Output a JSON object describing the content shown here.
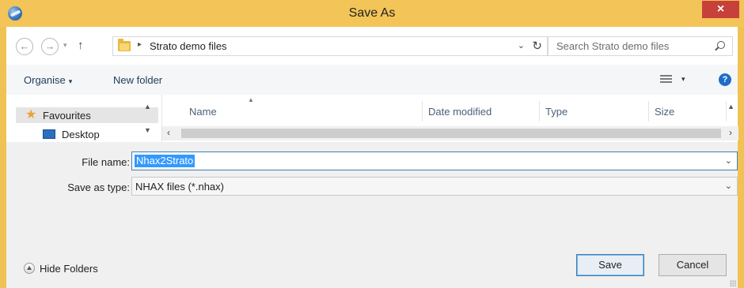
{
  "window": {
    "title": "Save As",
    "close_label": "×"
  },
  "address_bar": {
    "back_glyph": "←",
    "forward_glyph": "→",
    "up_glyph": "↑",
    "separator_glyph": "▸",
    "breadcrumb": "Strato demo files",
    "dropdown_glyph": "⌄",
    "refresh_glyph": "↻"
  },
  "search": {
    "placeholder": "Search Strato demo files"
  },
  "toolbar": {
    "organise_label": "Organise",
    "new_folder_label": "New folder",
    "help_glyph": "?"
  },
  "nav_pane": {
    "items": [
      {
        "label": "Favourites",
        "icon": "star-icon"
      },
      {
        "label": "Desktop",
        "icon": "desktop-icon"
      }
    ]
  },
  "file_list": {
    "columns": [
      "Name",
      "Date modified",
      "Type",
      "Size"
    ],
    "rows": []
  },
  "form": {
    "file_name_label": "File name:",
    "file_name_value": "Nhax2Strato",
    "save_type_label": "Save as type:",
    "save_type_value": "NHAX files (*.nhax)"
  },
  "footer": {
    "hide_folders_label": "Hide Folders",
    "save_label": "Save",
    "cancel_label": "Cancel"
  },
  "colors": {
    "titlebar": "#f3c457",
    "close_button": "#c7413a",
    "selection": "#3399ff",
    "accent_border": "#3c7fb1"
  }
}
